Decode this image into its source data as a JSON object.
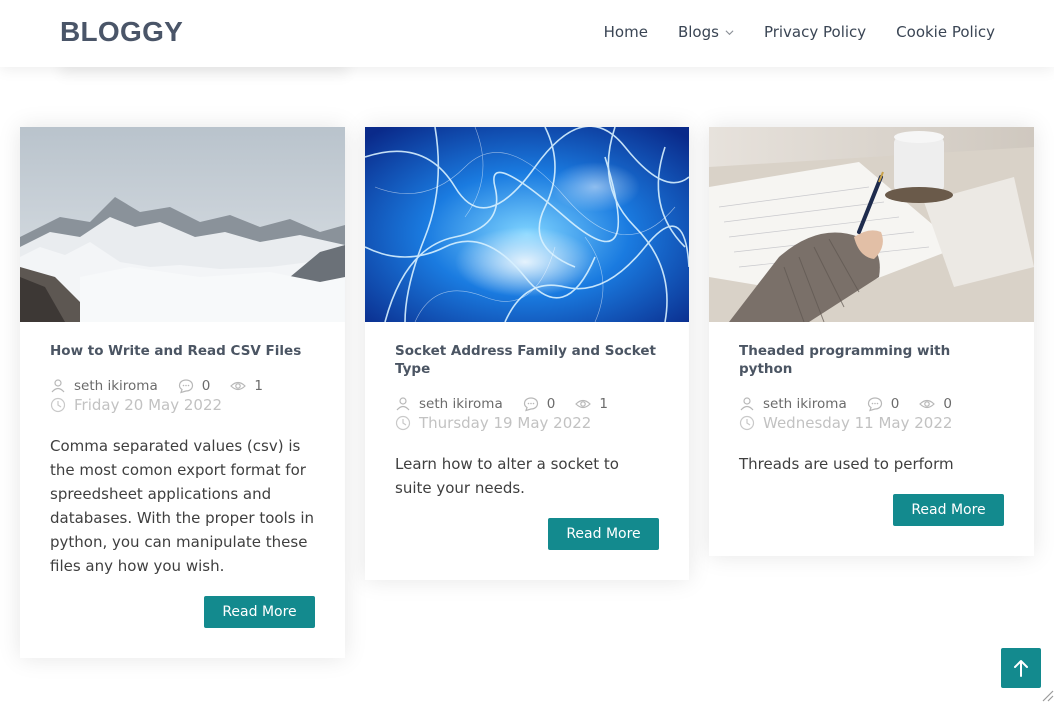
{
  "header": {
    "logo": "BLOGGY",
    "nav": [
      {
        "label": "Home"
      },
      {
        "label": "Blogs"
      },
      {
        "label": "Privacy Policy"
      },
      {
        "label": "Cookie Policy"
      }
    ]
  },
  "posts": [
    {
      "image": "snowy-mountains",
      "title": "How to Write and Read CSV Files",
      "author": "seth ikiroma",
      "comments": "0",
      "views": "1",
      "date": "Friday 20 May 2022",
      "excerpt": "Comma separated values (csv) is the most comon export format for spreedsheet applications and databases. With the proper tools in python, you can manipulate these files any how you wish.",
      "button": "Read More"
    },
    {
      "image": "blue-network",
      "title": "Socket Address Family and Socket Type",
      "author": "seth ikiroma",
      "comments": "0",
      "views": "1",
      "date": "Thursday 19 May 2022",
      "excerpt": "Learn how to alter a socket to suite your needs.",
      "button": "Read More"
    },
    {
      "image": "person-writing",
      "title": "Theaded programming with python",
      "author": "seth ikiroma",
      "comments": "0",
      "views": "0",
      "date": "Wednesday 11 May 2022",
      "excerpt": "Threads are used to perform",
      "button": "Read More"
    }
  ],
  "colors": {
    "accent": "#138a8e",
    "logo": "#4a5568",
    "date": "#c2c2c2"
  },
  "icons": [
    "user-icon",
    "comment-icon",
    "eye-icon",
    "clock-icon",
    "chevron-down-icon",
    "arrow-up-icon"
  ]
}
